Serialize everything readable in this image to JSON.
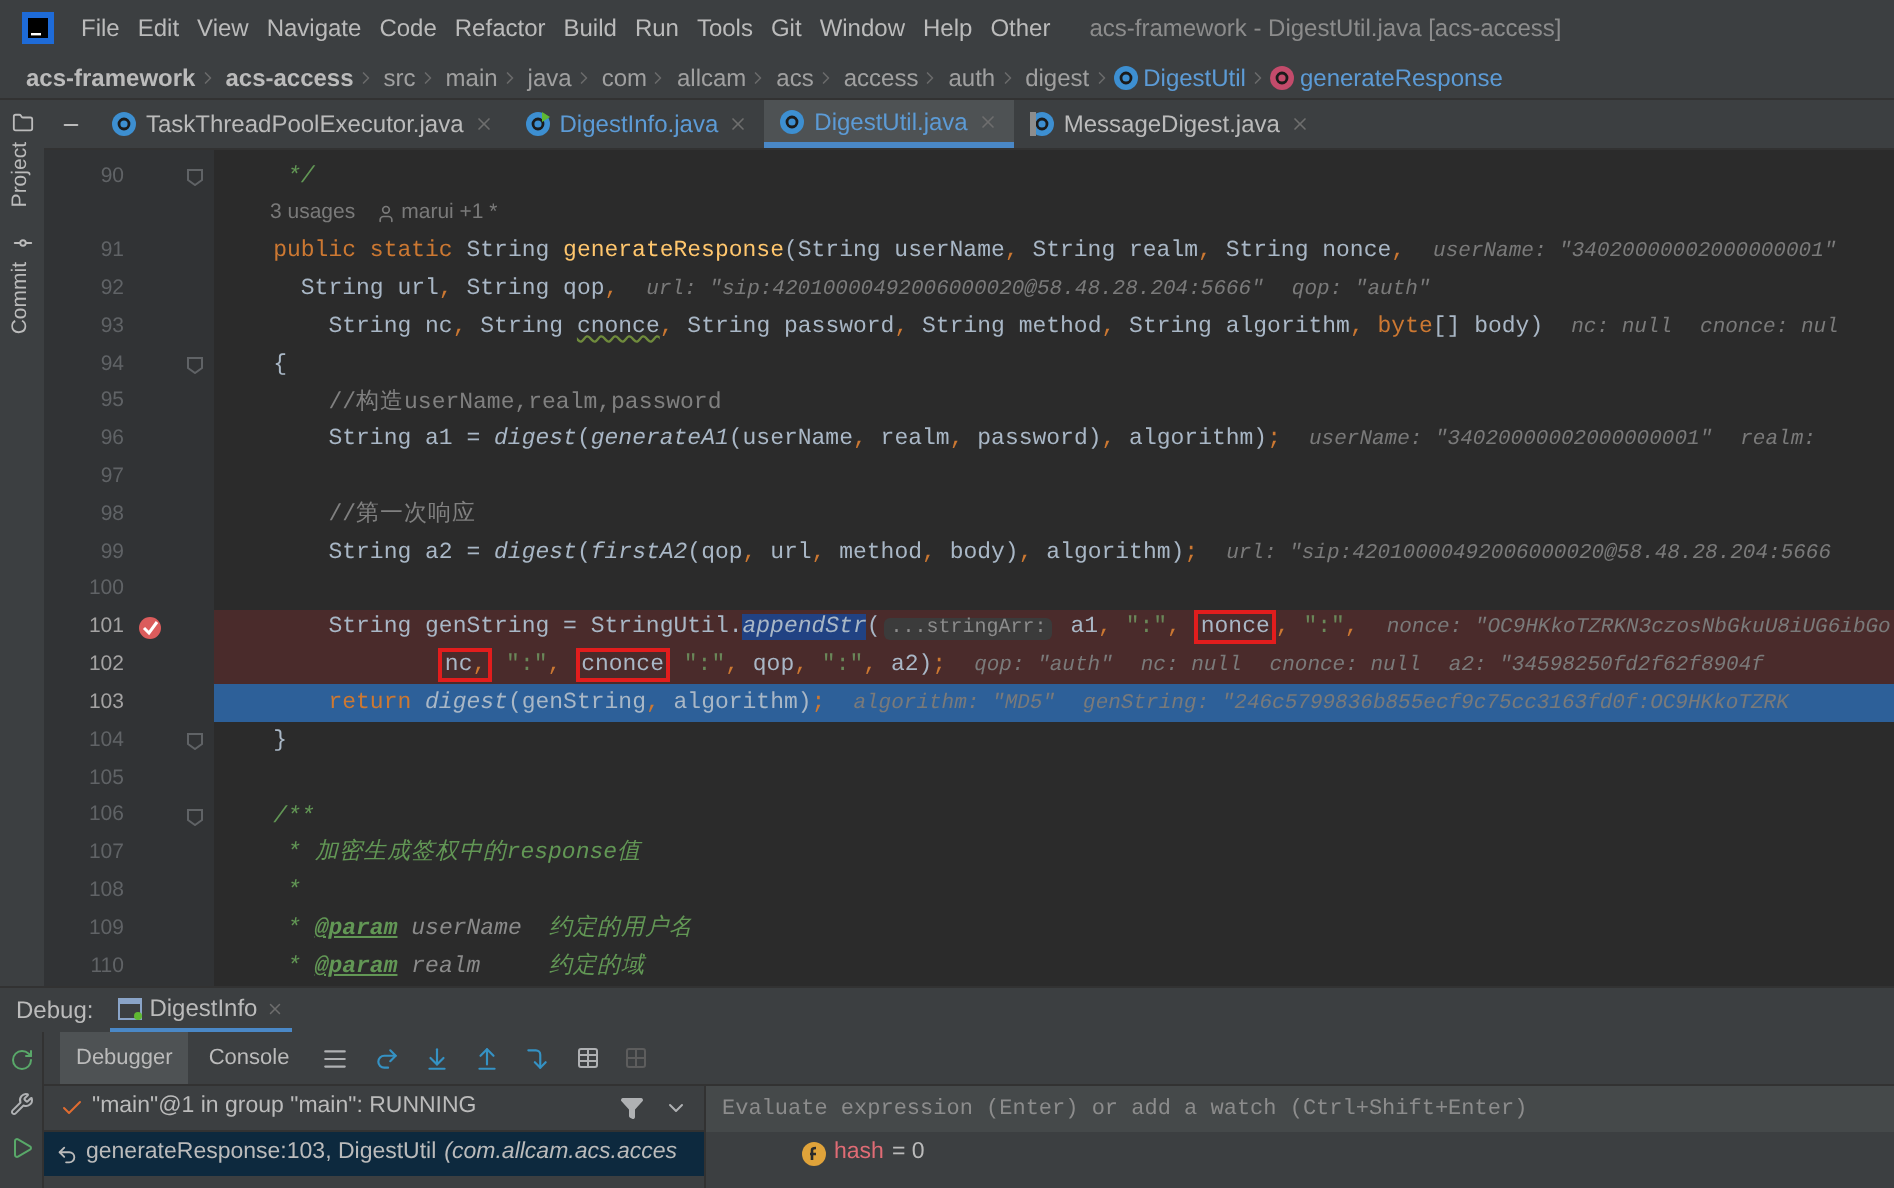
{
  "menu": {
    "items": [
      "File",
      "Edit",
      "View",
      "Navigate",
      "Code",
      "Refactor",
      "Build",
      "Run",
      "Tools",
      "Git",
      "Window",
      "Help",
      "Other"
    ],
    "title": "acs-framework - DigestUtil.java [acs-access]"
  },
  "breadcrumb": [
    {
      "label": "acs-framework",
      "kind": "module"
    },
    {
      "label": "acs-access",
      "kind": "module"
    },
    {
      "label": "src",
      "kind": "folder"
    },
    {
      "label": "main",
      "kind": "folder"
    },
    {
      "label": "java",
      "kind": "folder"
    },
    {
      "label": "com",
      "kind": "folder"
    },
    {
      "label": "allcam",
      "kind": "folder"
    },
    {
      "label": "acs",
      "kind": "folder"
    },
    {
      "label": "access",
      "kind": "folder"
    },
    {
      "label": "auth",
      "kind": "folder"
    },
    {
      "label": "digest",
      "kind": "folder"
    },
    {
      "label": "DigestUtil",
      "kind": "class"
    },
    {
      "label": "generateResponse",
      "kind": "method"
    }
  ],
  "side_tools": [
    {
      "label": "Project",
      "kind": "folder"
    },
    {
      "label": "Commit",
      "kind": "commit"
    }
  ],
  "tabs": [
    {
      "label": "TaskThreadPoolExecutor.java",
      "selected": false,
      "kind": "class"
    },
    {
      "label": "DigestInfo.java",
      "selected": false,
      "kind": "runnable"
    },
    {
      "label": "DigestUtil.java",
      "selected": true,
      "kind": "class"
    },
    {
      "label": "MessageDigest.java",
      "selected": false,
      "kind": "library"
    }
  ],
  "code": [
    {
      "kind": "code",
      "number": "90",
      "fold": true,
      "tokens": [
        {
          "text": "     */",
          "kind": "doc"
        }
      ]
    },
    {
      "kind": "usages",
      "usages": "3 usages",
      "author": "marui +1 *"
    },
    {
      "kind": "code",
      "number": "91",
      "tokens": [
        {
          "text": "    public static ",
          "kind": "kw"
        },
        {
          "text": "String ",
          "kind": "plain"
        },
        {
          "text": "generateResponse",
          "kind": "decl"
        },
        {
          "text": "(String userName, String realm, String nonce,",
          "kind": "plain"
        },
        {
          "text": "userName: \"34020000002000000001\"",
          "kind": "hint"
        }
      ]
    },
    {
      "kind": "code",
      "number": "92",
      "tokens": [
        {
          "text": "      String url, String qop,",
          "kind": "plain"
        },
        {
          "text": "url: \"sip:42010000492006000020@58.48.28.204:5666\"",
          "kind": "hint"
        },
        {
          "text": "qop: \"auth\"",
          "kind": "hint"
        }
      ]
    },
    {
      "kind": "code",
      "number": "93",
      "tokens": [
        {
          "text": "        String nc, String ",
          "kind": "plain"
        },
        {
          "text": "cnonce",
          "kind": "plain",
          "warning": true
        },
        {
          "text": ", String password, String method, String algorithm, ",
          "kind": "plain"
        },
        {
          "text": "byte",
          "kind": "kw"
        },
        {
          "text": "[] body)",
          "kind": "plain"
        },
        {
          "text": "nc: null",
          "kind": "hint"
        },
        {
          "text": "cnonce: nul",
          "kind": "hint"
        }
      ]
    },
    {
      "kind": "code",
      "number": "94",
      "fold": true,
      "tokens": [
        {
          "text": "    {",
          "kind": "plain"
        }
      ]
    },
    {
      "kind": "code",
      "number": "95",
      "tokens": [
        {
          "text": "        //构造userName,realm,password",
          "kind": "comment"
        }
      ]
    },
    {
      "kind": "code",
      "number": "96",
      "tokens": [
        {
          "text": "        String a1 = ",
          "kind": "plain"
        },
        {
          "text": "digest",
          "kind": "static"
        },
        {
          "text": "(",
          "kind": "plain"
        },
        {
          "text": "generateA1",
          "kind": "static"
        },
        {
          "text": "(userName, realm, password), algorithm);",
          "kind": "plain"
        },
        {
          "text": "userName: \"34020000002000000001\"",
          "kind": "hint"
        },
        {
          "text": "realm:",
          "kind": "hint"
        }
      ]
    },
    {
      "kind": "code",
      "number": "97"
    },
    {
      "kind": "code",
      "number": "98",
      "tokens": [
        {
          "text": "        //第一次响应",
          "kind": "comment"
        }
      ]
    },
    {
      "kind": "code",
      "number": "99",
      "tokens": [
        {
          "text": "        String a2 = ",
          "kind": "plain"
        },
        {
          "text": "digest",
          "kind": "static"
        },
        {
          "text": "(",
          "kind": "plain"
        },
        {
          "text": "firstA2",
          "kind": "static"
        },
        {
          "text": "(qop, url, method, body), algorithm);",
          "kind": "plain"
        },
        {
          "text": "url: \"sip:42010000492006000020@58.48.28.204:5666",
          "kind": "hint"
        }
      ]
    },
    {
      "kind": "code",
      "number": "100"
    },
    {
      "kind": "code",
      "number": "101",
      "breakpoint": true,
      "tokens": [
        {
          "text": "        String genString = StringUtil.",
          "kind": "plain"
        },
        {
          "text": "appendStr",
          "kind": "static",
          "selected": true
        },
        {
          "text": "(",
          "kind": "plain"
        },
        {
          "text": "...stringArr:",
          "kind": "chip"
        },
        {
          "text": " a1, ",
          "kind": "plain"
        },
        {
          "text": "\":\"",
          "kind": "string"
        },
        {
          "text": ", ",
          "kind": "plain"
        },
        {
          "text": "nonce",
          "kind": "plain",
          "boxed": true
        },
        {
          "text": ", ",
          "kind": "plain"
        },
        {
          "text": "\":\"",
          "kind": "string"
        },
        {
          "text": ",",
          "kind": "plain"
        },
        {
          "text": "nonce: \"OC9HKkoTZRKN3czosNbGkuU8iUG6ibGo",
          "kind": "hint"
        }
      ]
    },
    {
      "kind": "code",
      "number": "102",
      "breakpoint": true,
      "tokens": [
        {
          "text": "                nc,",
          "kind": "plain",
          "boxed": true
        },
        {
          "text": " \":\"",
          "kind": "string"
        },
        {
          "text": ", ",
          "kind": "plain"
        },
        {
          "text": "cnonce",
          "kind": "plain",
          "boxed": true
        },
        {
          "text": " \":\"",
          "kind": "string"
        },
        {
          "text": ", qop, ",
          "kind": "plain"
        },
        {
          "text": "\":\"",
          "kind": "string"
        },
        {
          "text": ", a2);",
          "kind": "plain"
        },
        {
          "text": "qop: \"auth\"",
          "kind": "hint"
        },
        {
          "text": "nc: null",
          "kind": "hint"
        },
        {
          "text": "cnonce: null",
          "kind": "hint"
        },
        {
          "text": "a2: \"34598250fd2f62f8904f",
          "kind": "hint"
        }
      ]
    },
    {
      "kind": "code",
      "number": "103",
      "current": true,
      "tokens": [
        {
          "text": "        return ",
          "kind": "kw"
        },
        {
          "text": "digest",
          "kind": "static"
        },
        {
          "text": "(genString, algorithm);",
          "kind": "plain"
        },
        {
          "text": "algorithm: \"MD5\"",
          "kind": "hint"
        },
        {
          "text": "genString: \"246c5799836b855ecf9c75cc3163fd0f:OC9HKkoTZRK",
          "kind": "hint"
        }
      ]
    },
    {
      "kind": "code",
      "number": "104",
      "fold": true,
      "tokens": [
        {
          "text": "    }",
          "kind": "plain"
        }
      ]
    },
    {
      "kind": "code",
      "number": "105"
    },
    {
      "kind": "code",
      "number": "106",
      "fold": true,
      "tokens": [
        {
          "text": "    /**",
          "kind": "doc"
        }
      ]
    },
    {
      "kind": "code",
      "number": "107",
      "tokens": [
        {
          "text": "     * 加密生成签权中的response值",
          "kind": "doc"
        }
      ]
    },
    {
      "kind": "code",
      "number": "108",
      "tokens": [
        {
          "text": "     *",
          "kind": "doc"
        }
      ]
    },
    {
      "kind": "code",
      "number": "109",
      "tokens": [
        {
          "text": "     * ",
          "kind": "doc"
        },
        {
          "text": "@param",
          "kind": "doctag"
        },
        {
          "text": " userName",
          "kind": "docparam"
        },
        {
          "text": "  约定的用户名",
          "kind": "doc"
        }
      ]
    },
    {
      "kind": "code",
      "number": "110",
      "tokens": [
        {
          "text": "     * ",
          "kind": "doc"
        },
        {
          "text": "@param",
          "kind": "doctag"
        },
        {
          "text": " realm",
          "kind": "docparam"
        },
        {
          "text": "     约定的域",
          "kind": "doc"
        }
      ]
    }
  ],
  "debug": {
    "label": "Debug:",
    "session_tab": "DigestInfo",
    "tabs": [
      {
        "label": "Debugger",
        "selected": true
      },
      {
        "label": "Console",
        "selected": false
      }
    ],
    "thread": "\"main\"@1 in group \"main\": RUNNING",
    "evaluate": {
      "placeholder": "Evaluate expression (Enter) or add a watch (Ctrl+Shift+Enter)"
    },
    "frames": [
      {
        "method": "generateResponse:103, DigestUtil",
        "package": "(com.allcam.acs.acces",
        "selected": true
      }
    ],
    "variables": [
      {
        "name": "hash",
        "value": "= 0"
      }
    ]
  }
}
